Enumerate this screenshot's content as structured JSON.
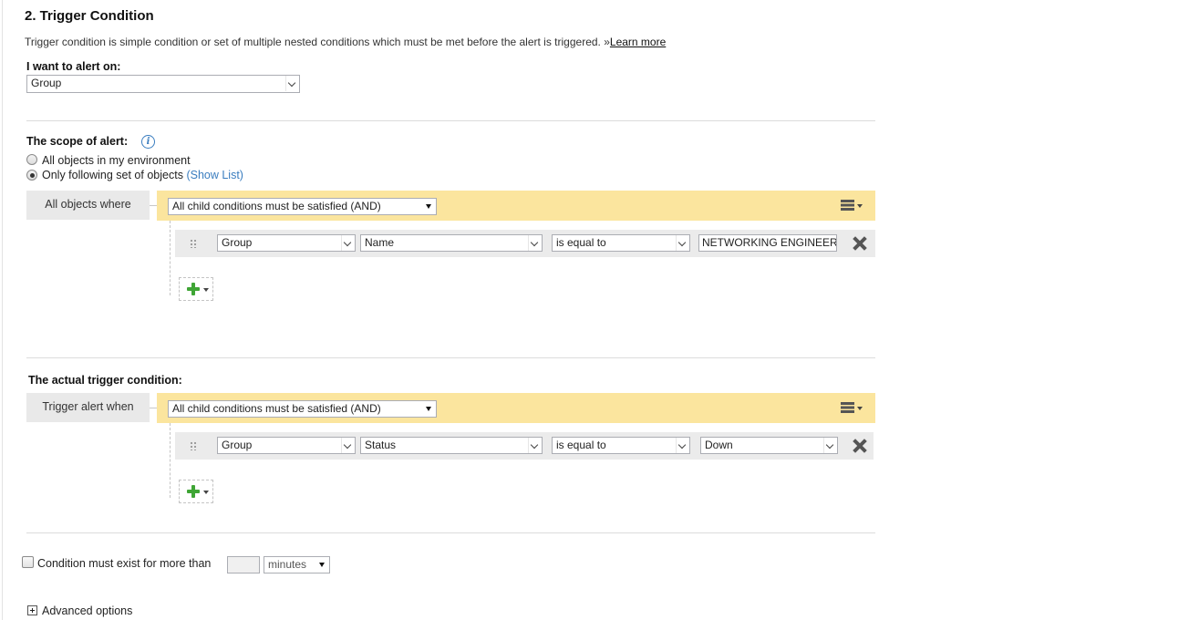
{
  "section": {
    "title": "2. Trigger Condition",
    "description": "Trigger condition is simple condition or set of multiple nested conditions which must be met before the alert is triggered. »",
    "learn_more": "Learn more"
  },
  "alert_on": {
    "label": "I want to alert on:",
    "value": "Group"
  },
  "scope": {
    "label": "The scope of alert:",
    "info_icon": "info-icon",
    "options": [
      {
        "label": "All objects in my environment",
        "checked": false
      },
      {
        "label": "Only following set of objects",
        "checked": true
      }
    ],
    "show_list": "(Show List)",
    "block_label": "All objects where",
    "group_operator": "All child conditions must be satisfied (AND)",
    "condition": {
      "object": "Group",
      "property": "Name",
      "operator": "is equal to",
      "value": "NETWORKING ENGINEER"
    }
  },
  "trigger": {
    "label": "The actual trigger condition:",
    "block_label": "Trigger alert when",
    "group_operator": "All child conditions must be satisfied (AND)",
    "condition": {
      "object": "Group",
      "property": "Status",
      "operator": "is equal to",
      "value": "Down"
    }
  },
  "duration": {
    "label": "Condition must exist for more than",
    "value": "",
    "unit": "minutes",
    "checked": false
  },
  "advanced": {
    "label": "Advanced options"
  },
  "colors": {
    "yellow_bar": "#fbe59e",
    "grey_label": "#e9e9e9",
    "link_blue": "#3a7dbf",
    "plus_green": "#3fa535"
  }
}
